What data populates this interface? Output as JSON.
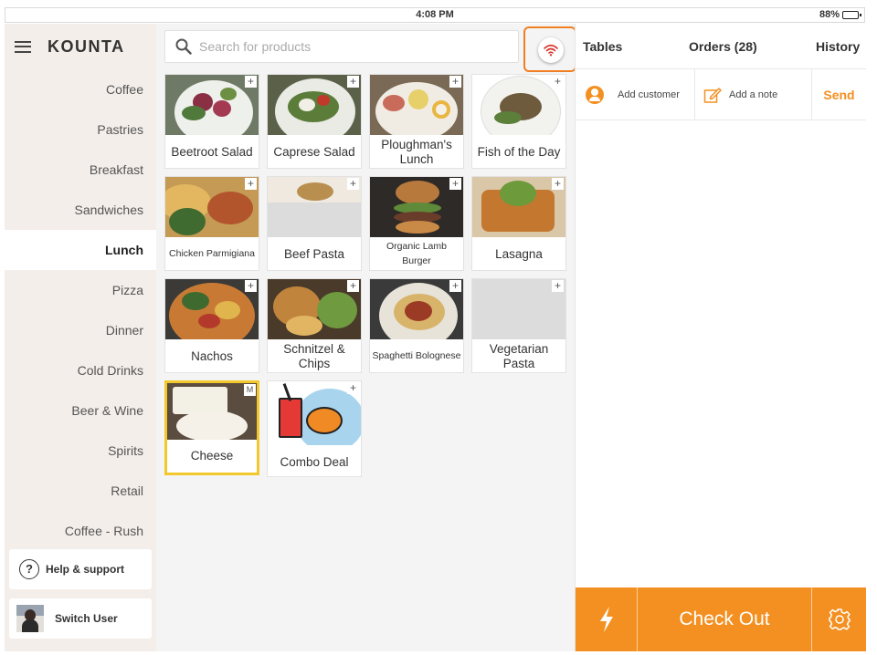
{
  "status_bar": {
    "time": "4:08 PM",
    "battery": "88%",
    "battery_level": 0.88
  },
  "brand": {
    "name": "KOUNTA"
  },
  "categories": [
    {
      "label": "Coffee"
    },
    {
      "label": "Pastries"
    },
    {
      "label": "Breakfast"
    },
    {
      "label": "Sandwiches"
    },
    {
      "label": "Lunch",
      "active": true
    },
    {
      "label": "Pizza"
    },
    {
      "label": "Dinner"
    },
    {
      "label": "Cold Drinks"
    },
    {
      "label": "Beer & Wine"
    },
    {
      "label": "Spirits"
    },
    {
      "label": "Retail"
    },
    {
      "label": "Coffee - Rush"
    }
  ],
  "sidebar_buttons": {
    "help": "Help & support",
    "switch_user": "Switch User"
  },
  "search": {
    "placeholder": "Search for products"
  },
  "products": [
    {
      "name": "Beetroot Salad",
      "badge": "+"
    },
    {
      "name": "Caprese Salad",
      "badge": "+"
    },
    {
      "name": "Ploughman's Lunch",
      "badge": "+"
    },
    {
      "name": "Fish of the Day",
      "badge": "+"
    },
    {
      "name": "Chicken Parmigiana",
      "badge": "+"
    },
    {
      "name": "Beef Pasta",
      "badge": "+"
    },
    {
      "name": "Organic Lamb Burger",
      "badge": "+"
    },
    {
      "name": "Lasagna",
      "badge": "+"
    },
    {
      "name": "Nachos",
      "badge": "+"
    },
    {
      "name": "Schnitzel & Chips",
      "badge": "+"
    },
    {
      "name": "Spaghetti Bolognese",
      "badge": "+"
    },
    {
      "name": "Vegetarian Pasta",
      "badge": "+"
    },
    {
      "name": "Cheese",
      "badge": "M",
      "selected": true
    },
    {
      "name": "Combo Deal",
      "badge": "+"
    }
  ],
  "order_panel": {
    "tabs": {
      "tables": "Tables",
      "orders": "Orders (28)",
      "history": "History"
    },
    "actions": {
      "add_customer": "Add customer",
      "add_note": "Add a note",
      "send": "Send"
    },
    "checkout": "Check Out"
  },
  "colors": {
    "accent": "#f39021",
    "selected_border": "#f2c82d",
    "sidebar_bg": "#f3eeea"
  }
}
